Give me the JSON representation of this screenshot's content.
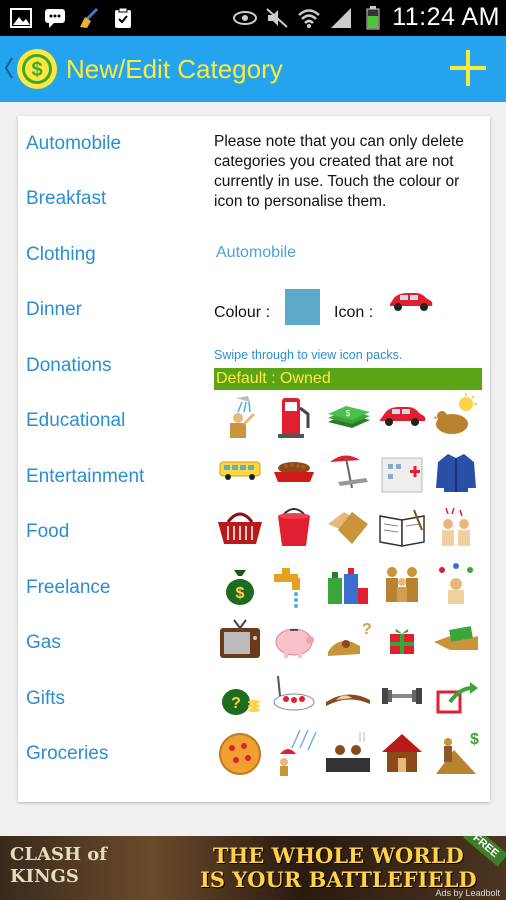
{
  "status_bar": {
    "time": "11:24 AM",
    "left_icons": [
      "image-icon",
      "chat-icon",
      "broom-icon",
      "clipboard-check-icon"
    ],
    "right_icons": [
      "eye-icon",
      "mute-icon",
      "wifi-icon",
      "signal-icon",
      "battery-icon"
    ]
  },
  "action_bar": {
    "title": "New/Edit Category",
    "icons": [
      "back-chevron-icon",
      "dollar-logo-icon",
      "plus-icon"
    ]
  },
  "categories": [
    "Automobile",
    "Breakfast",
    "Clothing",
    "Dinner",
    "Donations",
    "Educational",
    "Entertainment",
    "Food",
    "Freelance",
    "Gas",
    "Gifts",
    "Groceries"
  ],
  "editor": {
    "note": "Please note that you can only delete categories you created that are not currently in use. Touch the colour or icon to personalise them.",
    "category_name": "Automobile",
    "colour_label": "Colour :",
    "colour_value": "#5da9c9",
    "icon_label": "Icon :",
    "current_icon": "car-icon",
    "swipe_hint": "Swipe through to view icon packs.",
    "pack_title": "Default : Owned"
  },
  "icon_grid": [
    [
      "shower-icon",
      "fuel-pump-icon",
      "money-stack-icon",
      "car-icon",
      "sun-bird-icon"
    ],
    [
      "bus-icon",
      "pet-bowl-icon",
      "beach-icon",
      "hospital-icon",
      "jacket-icon"
    ],
    [
      "basket-icon",
      "bucket-icon",
      "handshake-icon",
      "book-icon",
      "celebration-icon"
    ],
    [
      "money-bag-icon",
      "faucet-icon",
      "cleaning-supplies-icon",
      "family-icon",
      "juggler-icon"
    ],
    [
      "tv-icon",
      "piggy-bank-icon",
      "question-hand-icon",
      "gift-icon",
      "payment-hand-icon"
    ],
    [
      "question-bag-icon",
      "restaurant-icon",
      "sushi-icon",
      "dumbbell-icon",
      "export-icon"
    ],
    [
      "pizza-icon",
      "rain-icon",
      "grill-icon",
      "house-icon",
      "construction-icon"
    ]
  ],
  "ad": {
    "brand_line1": "CLASH of",
    "brand_line2": "KINGS",
    "headline1": "THE WHOLE WORLD",
    "headline2": "IS YOUR BATTLEFIELD",
    "badge": "FREE",
    "attribution": "Ads by Leadbolt"
  },
  "colors": {
    "action_bar": "#24a4ee",
    "title": "#ffea3a",
    "link": "#2a8fd0",
    "pack_bar": "#5aa515"
  }
}
